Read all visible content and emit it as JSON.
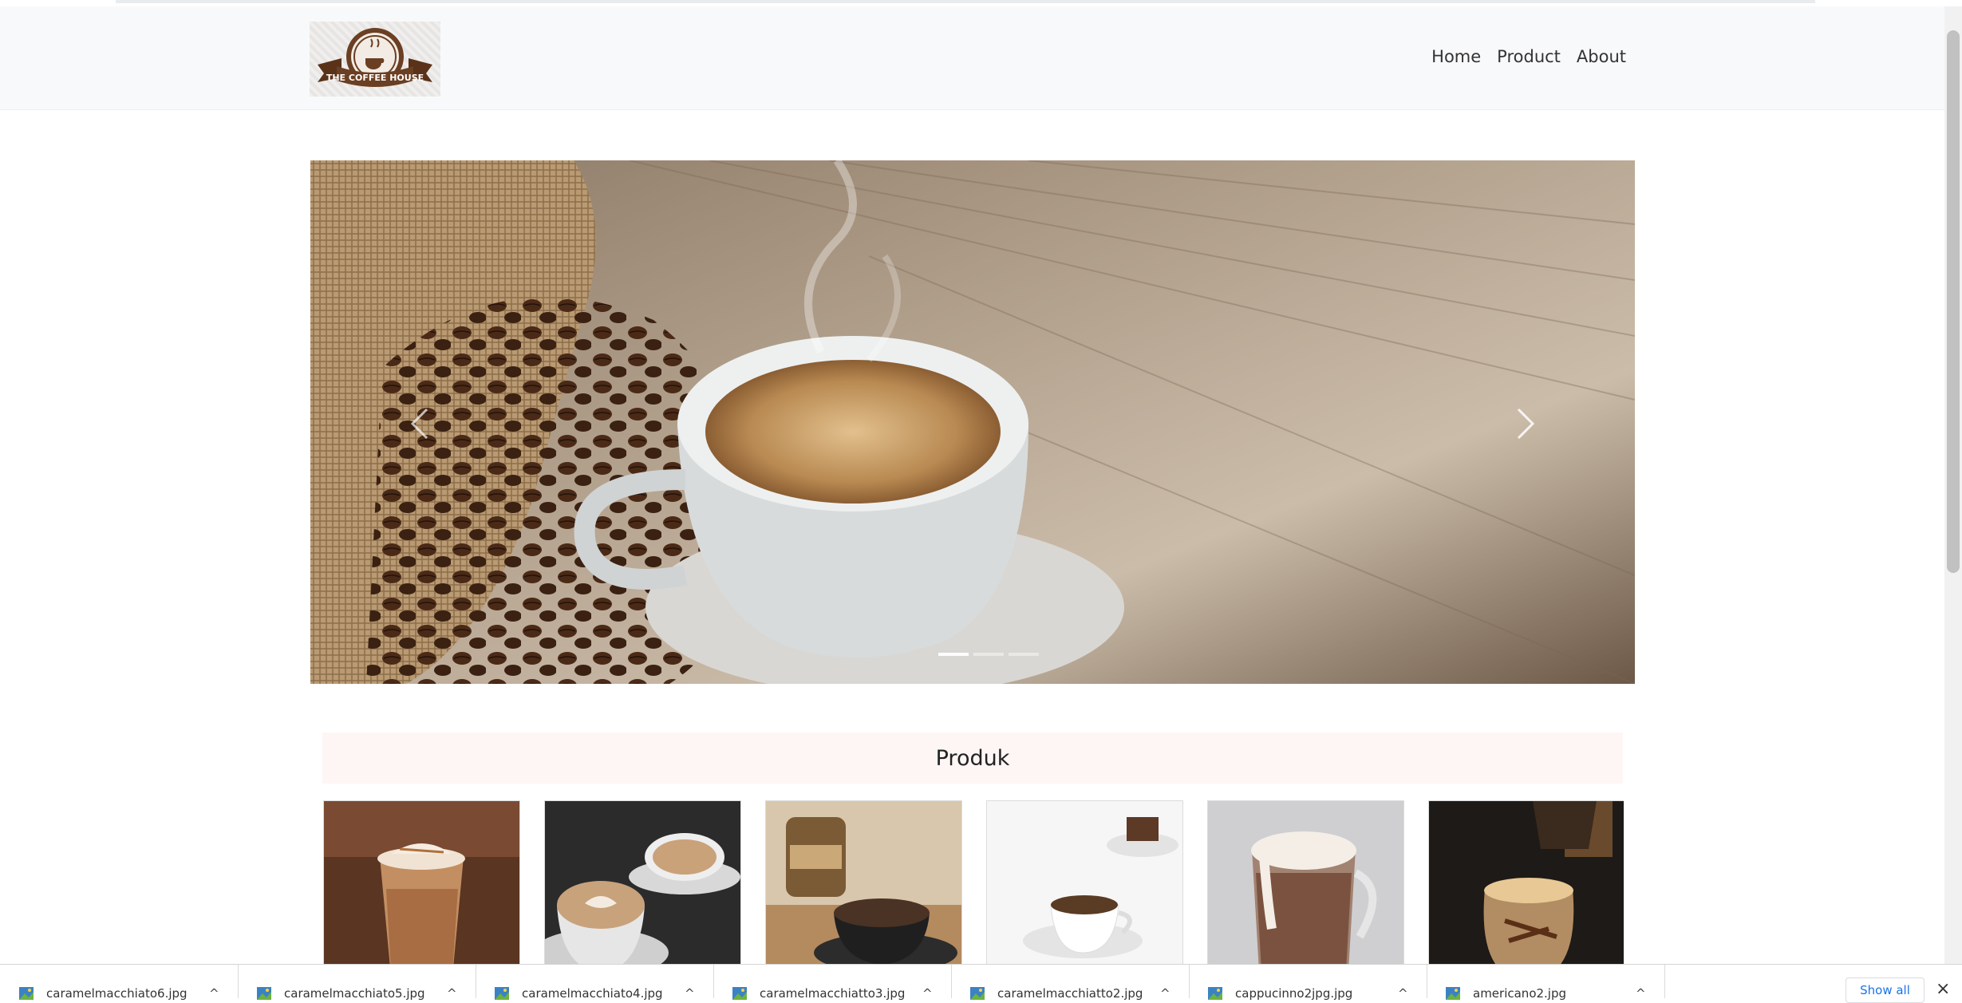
{
  "navbar": {
    "logo_text": "THE COFFEE HOUSE",
    "links": [
      "Home",
      "Product",
      "About"
    ]
  },
  "carousel": {
    "slide_count": 3,
    "active_slide": 1
  },
  "products_section": {
    "title": "Produk",
    "cards": [
      "iced-caramel-macchiato",
      "latte-art-cups",
      "coffee-jar-and-cup",
      "espresso-with-brownie",
      "hot-chocolate-mug",
      "coffee-drip-glass"
    ]
  },
  "downloads": {
    "items": [
      "caramelmacchiato6.jpg",
      "caramelmacchiato5.jpg",
      "caramelmacchiato4.jpg",
      "caramelmacchiatto3.jpg",
      "caramelmacchiatto2.jpg",
      "cappucinno2jpg.jpg",
      "americano2.jpg"
    ],
    "show_all_label": "Show all",
    "close_icon": "×"
  },
  "colors": {
    "navbar_bg": "#f8f9fa",
    "section_header_bg": "#fdf6f4",
    "link_blue": "#1a73e8",
    "brand_brown": "#6b3f23"
  }
}
